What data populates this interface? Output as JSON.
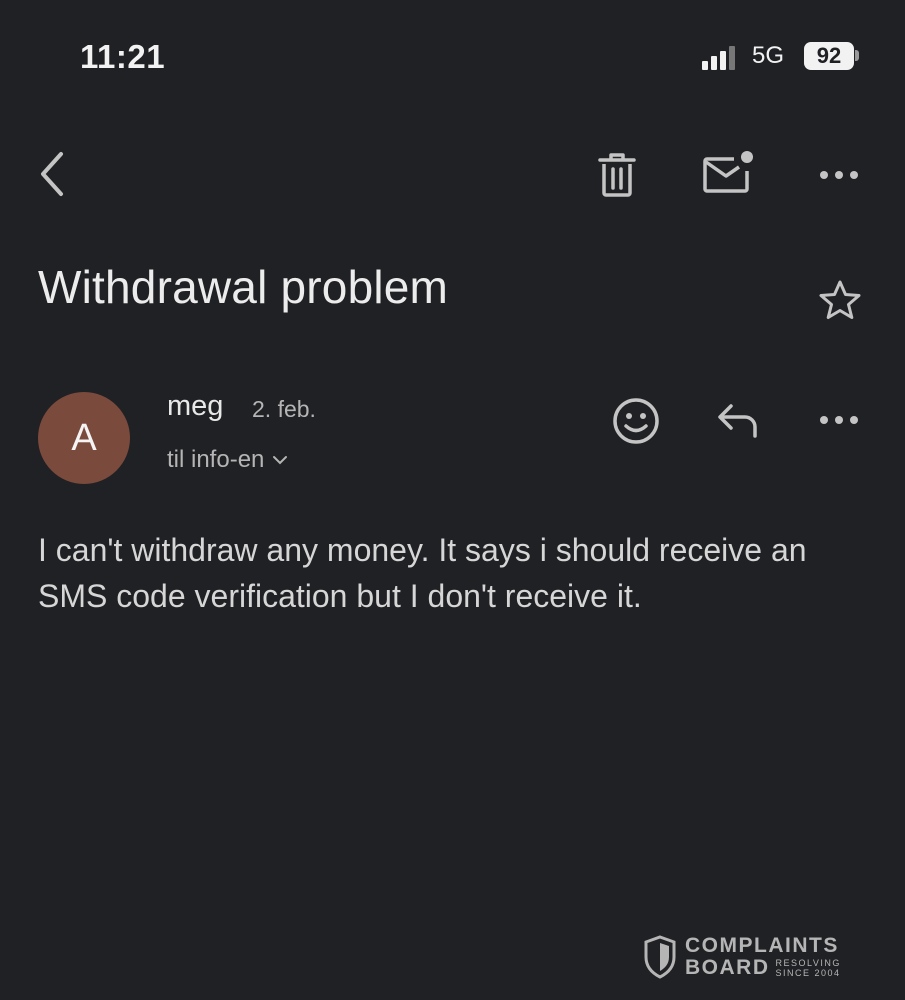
{
  "status_bar": {
    "time": "11:21",
    "network": "5G",
    "battery": "92"
  },
  "toolbar": {
    "back_icon": "chevron-left-icon",
    "delete_icon": "trash-icon",
    "mark_unread_icon": "mail-unread-icon",
    "more_icon": "more-horizontal-icon"
  },
  "email": {
    "subject": "Withdrawal problem",
    "avatar_letter": "A",
    "avatar_color": "#7a4a3c",
    "sender": "meg",
    "date": "2. feb.",
    "recipient": "til info-en",
    "body": "I can't withdraw any money. It says i should receive an SMS code verification but I don't receive it."
  },
  "watermark": {
    "line1": "COMPLAINTS",
    "line2": "BOARD",
    "tag1": "RESOLVING",
    "tag2": "SINCE 2004"
  }
}
